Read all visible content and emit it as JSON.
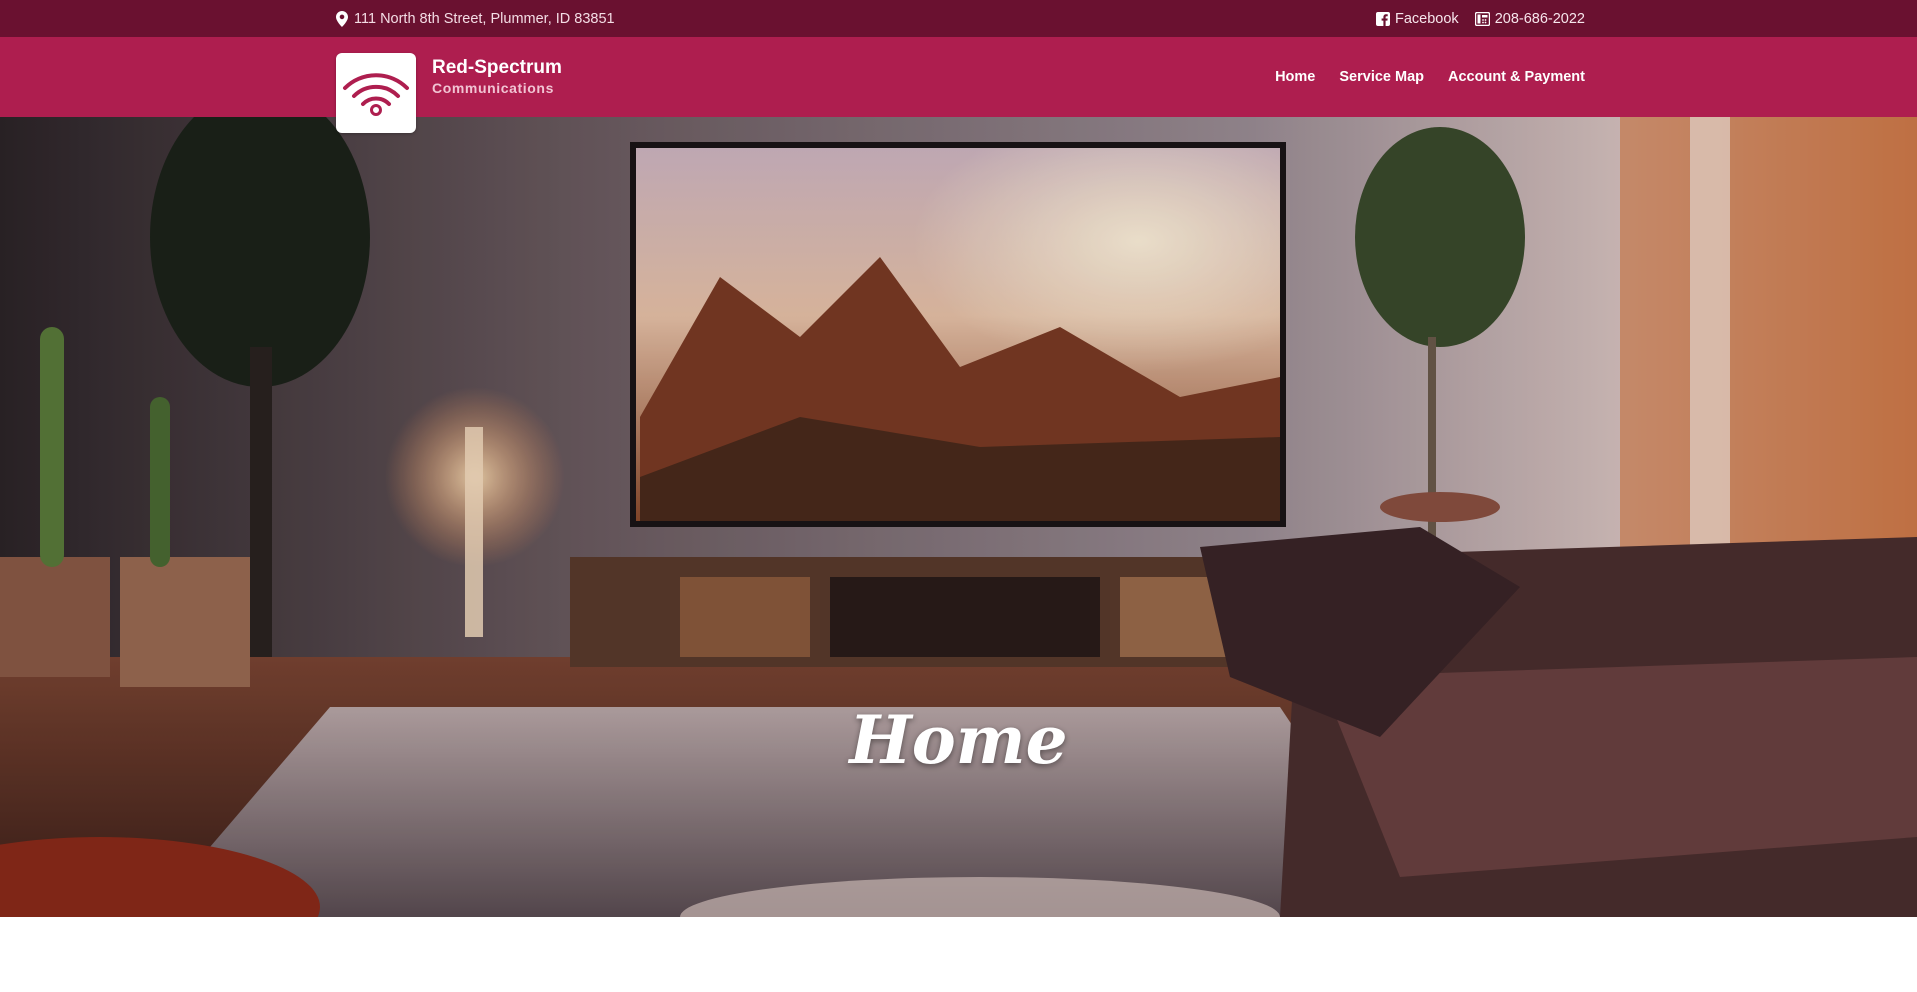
{
  "topbar": {
    "address": "111 North 8th Street, Plummer, ID 83851",
    "facebook_label": "Facebook",
    "phone": "208-686-2022",
    "icons": {
      "address": "map-pin-icon",
      "facebook": "facebook-icon",
      "phone": "phone-icon"
    }
  },
  "header": {
    "brand_name": "Red-Spectrum",
    "brand_sub": "Communications",
    "logo_icon": "wifi-icon",
    "nav": [
      {
        "label": "Home"
      },
      {
        "label": "Service Map"
      },
      {
        "label": "Account & Payment"
      }
    ]
  },
  "hero": {
    "title": "Home"
  },
  "colors": {
    "topbar_bg": "#6a1130",
    "navbar_bg": "#ae1e4f",
    "logo_accent": "#ae1e4f",
    "text_light": "#ffffff"
  }
}
